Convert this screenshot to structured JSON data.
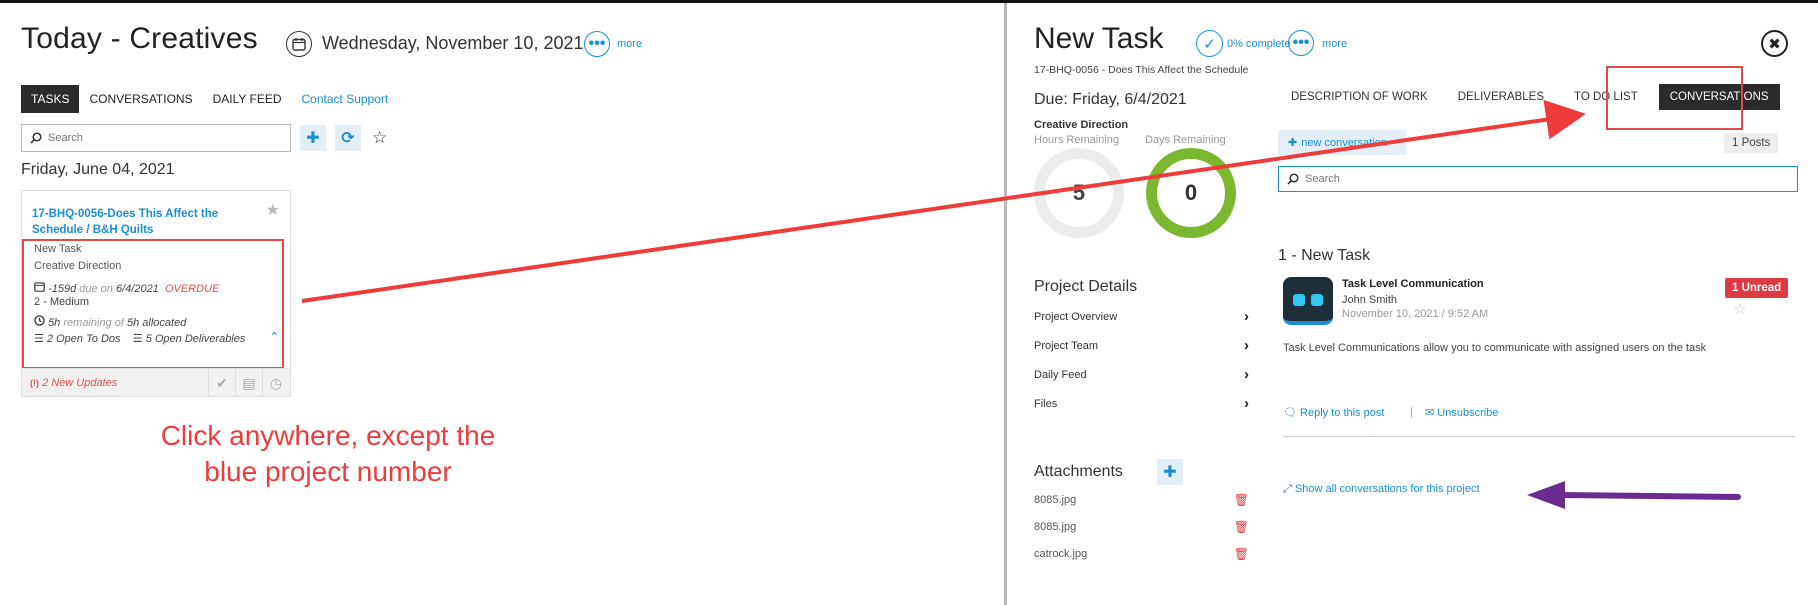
{
  "left": {
    "title": "Today - Creatives",
    "date": "Wednesday, November 10, 2021",
    "more": "more",
    "tabs": [
      {
        "label": "TASKS",
        "active": true
      },
      {
        "label": "CONVERSATIONS"
      },
      {
        "label": "DAILY FEED"
      },
      {
        "label": "Contact Support"
      }
    ],
    "search_placeholder": "Search",
    "day_header": "Friday, June 04, 2021",
    "card": {
      "title": "17-BHQ-0056-Does This Affect the Schedule / B&H Quilts",
      "task_name": "New Task",
      "role": "Creative Direction",
      "days": "-159d",
      "due_text": "due on",
      "due_date": "6/4/2021",
      "overdue": "OVERDUE",
      "priority": "2 - Medium",
      "hours_remaining": "5h",
      "remaining_text": "remaining of",
      "hours_allocated": "5h allocated",
      "todos": "2 Open To Dos",
      "deliverables": "5 Open Deliverables",
      "updates": "2 New Updates"
    },
    "annotation": "Click anywhere, except the blue project number"
  },
  "right": {
    "title": "New Task",
    "complete": "0% complete",
    "more": "more",
    "project_sub": "17-BHQ-0056 - Does This Affect the Schedule",
    "due": "Due: Friday, 6/4/2021",
    "direction": "Creative Direction",
    "hours_label": "Hours Remaining",
    "days_label": "Days Remaining",
    "hours_value": "5",
    "days_value": "0",
    "tabs": [
      {
        "label": "DESCRIPTION OF WORK"
      },
      {
        "label": "DELIVERABLES"
      },
      {
        "label": "TO DO LIST"
      },
      {
        "label": "CONVERSATIONS",
        "active": true
      }
    ],
    "new_conversation": "new conversation",
    "posts": "1 Posts",
    "search_placeholder": "Search",
    "conv_title": "1 - New Task",
    "post": {
      "heading": "Task Level Communication",
      "author": "John Smith",
      "date": "November 10, 2021 / 9:52 AM",
      "unread": "1 Unread",
      "body": "Task Level Communications allow you to communicate with assigned users on the task",
      "reply": "Reply to this post",
      "separator": "|",
      "unsubscribe": "Unsubscribe"
    },
    "show_all": "Show all conversations for this project",
    "project_details": {
      "title": "Project Details",
      "items": [
        "Project Overview",
        "Project Team",
        "Daily Feed",
        "Files"
      ]
    },
    "attachments": {
      "title": "Attachments",
      "items": [
        "8085.jpg",
        "8085.jpg",
        "catrock.jpg"
      ]
    }
  },
  "colors": {
    "accent": "#1a8fd0",
    "annotation_red": "#ef3b3b",
    "annotation_purple": "#6a2c8e",
    "ring_green": "#7cb82f",
    "unread_red": "#dc3b42"
  }
}
